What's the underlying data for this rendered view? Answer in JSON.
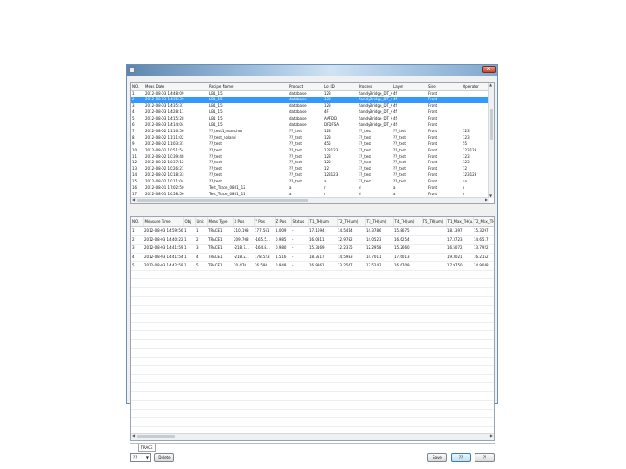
{
  "window": {
    "close_label": "x"
  },
  "top_table": {
    "headers": [
      "NO.",
      "Meas Date",
      "Recipe Name",
      "Product",
      "Lot ID",
      "Process",
      "Layer",
      "Side",
      "Operator"
    ],
    "selected_index": 1,
    "rows": [
      [
        "1",
        "2012-08-03 14:48:09",
        "LB1_15",
        "database",
        "123",
        "SandyBridge_DT_M",
        "4f",
        "Front",
        ""
      ],
      [
        "2",
        "2012-08-03 14:36:39",
        "LB1_15",
        "database",
        "123",
        "SandyBridge_DT_M",
        "4f",
        "Front",
        ""
      ],
      [
        "3",
        "2012-08-03 14:35:37",
        "LB1_15",
        "database",
        "123",
        "SandyBridge_DT_M",
        "4f",
        "Front",
        ""
      ],
      [
        "4",
        "2012-08-03 14:28:11",
        "LB1_15",
        "database",
        "4F",
        "SandyBridge_DT_M",
        "4f",
        "Front",
        ""
      ],
      [
        "5",
        "2012-08-03 14:15:28",
        "LB1_15",
        "database",
        "AAFDD",
        "SandyBridge_DT_M",
        "4f",
        "Front",
        ""
      ],
      [
        "6",
        "2012-08-03 14:14:04",
        "LB1_15",
        "database",
        "DFDFSA",
        "SandyBridge_DT_M",
        "4f",
        "Front",
        ""
      ],
      [
        "7",
        "2012-08-02 11:16:56",
        "??_test1_nsanchor",
        "??_test",
        "123",
        "??_test",
        "??_test",
        "Front",
        "123"
      ],
      [
        "8",
        "2012-08-02 11:11:02",
        "??_test_holand",
        "??_test",
        "123",
        "??_test",
        "??_test",
        "Front",
        "123"
      ],
      [
        "9",
        "2012-08-02 11:03:31",
        "??_test",
        "??_test",
        "455",
        "??_test",
        "??_test",
        "Front",
        "55"
      ],
      [
        "10",
        "2012-08-02 10:51:54",
        "??_test",
        "??_test",
        "123123",
        "??_test",
        "??_test",
        "Front",
        "123123"
      ],
      [
        "11",
        "2012-08-02 10:39:48",
        "??_test",
        "??_test",
        "123",
        "??_test",
        "??_test",
        "Front",
        "123"
      ],
      [
        "12",
        "2012-08-02 10:37:12",
        "??_test",
        "??_test",
        "123",
        "??_test",
        "??_test",
        "Front",
        "123"
      ],
      [
        "13",
        "2012-08-02 10:26:21",
        "??_test",
        "??_test",
        "12",
        "??_test",
        "??_test",
        "Front",
        "12"
      ],
      [
        "14",
        "2012-08-02 10:18:33",
        "??_test",
        "??_test",
        "123123",
        "??_test",
        "??_test",
        "Front",
        "123123"
      ],
      [
        "15",
        "2012-08-02 10:11:04",
        "??_test",
        "??_test",
        "a",
        "??_test",
        "??_test",
        "Front",
        "aa"
      ],
      [
        "16",
        "2012-08-01 17:02:50",
        "Test_Trace_0801_12",
        "a",
        "r",
        "d",
        "a",
        "Front",
        "r"
      ],
      [
        "17",
        "2012-08-01 16:58:56",
        "Test_Trace_0801_11",
        "a",
        "r",
        "d",
        "a",
        "Front",
        "r"
      ]
    ]
  },
  "bottom_table": {
    "headers": [
      "NO.",
      "Measure Time",
      "Obj",
      "Unit",
      "Meas Type",
      "X Pos",
      "Y Pos",
      "Z Pos",
      "Status",
      "T1_TH(um)",
      "T2_TH(um)",
      "T3_TH(um)",
      "T4_TH(um)",
      "T5_TH(um)",
      "T1_Max_TH(u...",
      "T2_Max_TH(u..."
    ],
    "rows": [
      [
        "1",
        "2012-08-03 14:59:56",
        "1",
        "1",
        "TRACE1",
        "210.198",
        "177.561",
        "1.009",
        "-",
        "17.1694",
        "14.5414",
        "14.3786",
        "15.8675",
        "",
        "18.1397",
        "15.3297"
      ],
      [
        "2",
        "2012-08-03 14:40:22",
        "1",
        "2",
        "TRACE1",
        "209.708",
        "-165.5...",
        "0.985",
        "-",
        "16.0811",
        "12.9782",
        "14.0523",
        "16.6254",
        "",
        "17.3723",
        "14.6517"
      ],
      [
        "3",
        "2012-08-03 14:41:59",
        "1",
        "3",
        "TRACE1",
        "-218.7...",
        "-164.8...",
        "0.980",
        "-",
        "15.3169",
        "12.2375",
        "12.2958",
        "15.2660",
        "",
        "16.5072",
        "13.7922"
      ],
      [
        "4",
        "2012-08-03 14:41:54",
        "1",
        "4",
        "TRACE1",
        "-218.2...",
        "178.523",
        "1.516",
        "-",
        "18.3517",
        "14.5983",
        "14.7011",
        "17.6013",
        "",
        "19.3021",
        "16.2152"
      ],
      [
        "5",
        "2012-08-03 14:42:59",
        "1",
        "5",
        "TRACE1",
        "20.470",
        "26.598",
        "0.948",
        "-",
        "16.9861",
        "13.2567",
        "13.5243",
        "16.6709",
        "",
        "17.9750",
        "14.9048"
      ]
    ]
  },
  "tabs": {
    "trace": "TRACE"
  },
  "footer": {
    "combo_value": "??",
    "delete_label": "Delete",
    "save_label": "Save",
    "ok_label": "??",
    "cancel_label": "??"
  }
}
